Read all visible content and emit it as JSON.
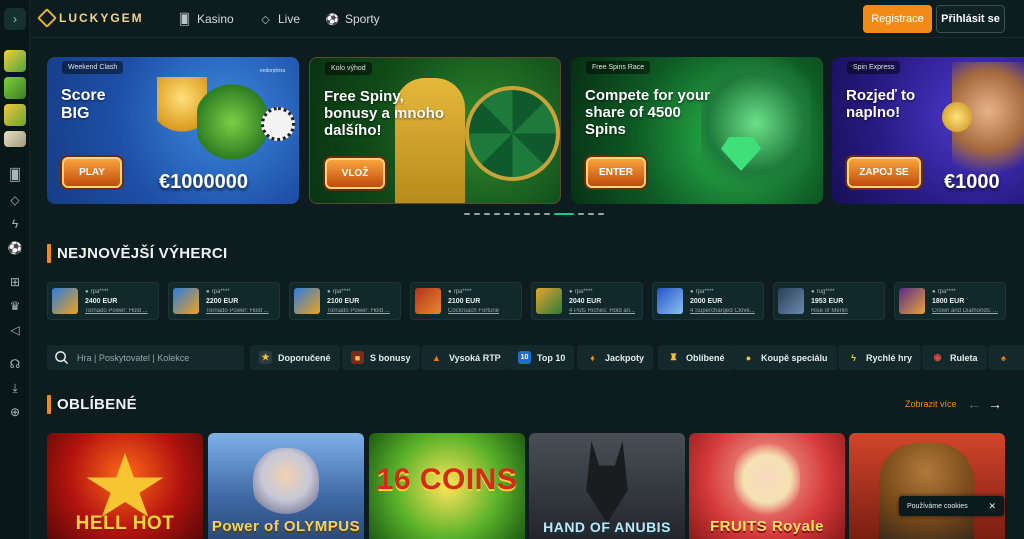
{
  "brand": {
    "name": "LUCKYGEM",
    "accent": "#f08a19",
    "primary": "#0d1d1f"
  },
  "nav": [
    {
      "label": "Kasino",
      "icon": "cards-icon"
    },
    {
      "label": "Live",
      "icon": "diamond-icon"
    },
    {
      "label": "Sporty",
      "icon": "soccer-ball-icon"
    }
  ],
  "auth": {
    "register": "Registrace",
    "login": "Přihlásit se"
  },
  "banners": [
    {
      "tag": "Weekend Clash",
      "title": "Score BIG",
      "button": "PLAY",
      "amount": "€1000000",
      "badge": "endorphina"
    },
    {
      "tag": "Kolo výhod",
      "title": "Free Spiny, bonusy a mnoho dalšího!",
      "button": "VLOŽ"
    },
    {
      "tag": "Free Spins Race",
      "title": "Compete for your share of 4500 Spins",
      "button": "ENTER"
    },
    {
      "tag": "Spin Express",
      "title": "Rozjeď to naplno!",
      "button": "ZAPOJ SE",
      "amount": "€1000"
    }
  ],
  "winners_title": "NEJNOVĚJŠÍ VÝHERCI",
  "winners": [
    {
      "user": "rpa****",
      "amount": "2400 EUR",
      "game": "Tornado Power: Hold ..."
    },
    {
      "user": "rpa****",
      "amount": "2200 EUR",
      "game": "Tornado Power: Hold ..."
    },
    {
      "user": "rpa****",
      "amount": "2100 EUR",
      "game": "Tornado Power: Hold ..."
    },
    {
      "user": "rpa****",
      "amount": "2100 EUR",
      "game": "Cockroach Fortune"
    },
    {
      "user": "rpa****",
      "amount": "2040 EUR",
      "game": "4 Pots Riches: Hold an..."
    },
    {
      "user": "rpa****",
      "amount": "2000 EUR",
      "game": "4 Supercharged Clove..."
    },
    {
      "user": "rug****",
      "amount": "1953 EUR",
      "game": "Rise of Merlin"
    },
    {
      "user": "rpa****",
      "amount": "1800 EUR",
      "game": "Crown and Diamonds: ..."
    }
  ],
  "search": {
    "placeholder": "Hra | Poskytovatel | Kolekce"
  },
  "filters": [
    {
      "label": "Doporučené",
      "icon": "star-badge-icon"
    },
    {
      "label": "S bonusy",
      "icon": "gift-icon"
    },
    {
      "label": "Vysoká RTP",
      "icon": "flame-icon"
    },
    {
      "label": "Top 10",
      "icon": "top-ten-icon"
    },
    {
      "label": "Jackpoty",
      "icon": "jackpot-icon"
    },
    {
      "label": "Oblíbené",
      "icon": "trophy-icon"
    },
    {
      "label": "Koupě speciálu",
      "icon": "coins-icon"
    },
    {
      "label": "Rychlé hry",
      "icon": "lightning-icon"
    },
    {
      "label": "Ruleta",
      "icon": "roulette-icon"
    }
  ],
  "favorites": {
    "title": "OBLÍBENÉ",
    "see_more": "Zobrazit více"
  },
  "games": [
    {
      "title": "HELL HOT"
    },
    {
      "title": "Power of OLYMPUS"
    },
    {
      "title": "16 COINS"
    },
    {
      "title": "HAND OF ANUBIS"
    },
    {
      "title": "FRUITS Royale"
    },
    {
      "title": ""
    }
  ],
  "cookie": {
    "text": "Používáme cookies",
    "close": "✕"
  }
}
